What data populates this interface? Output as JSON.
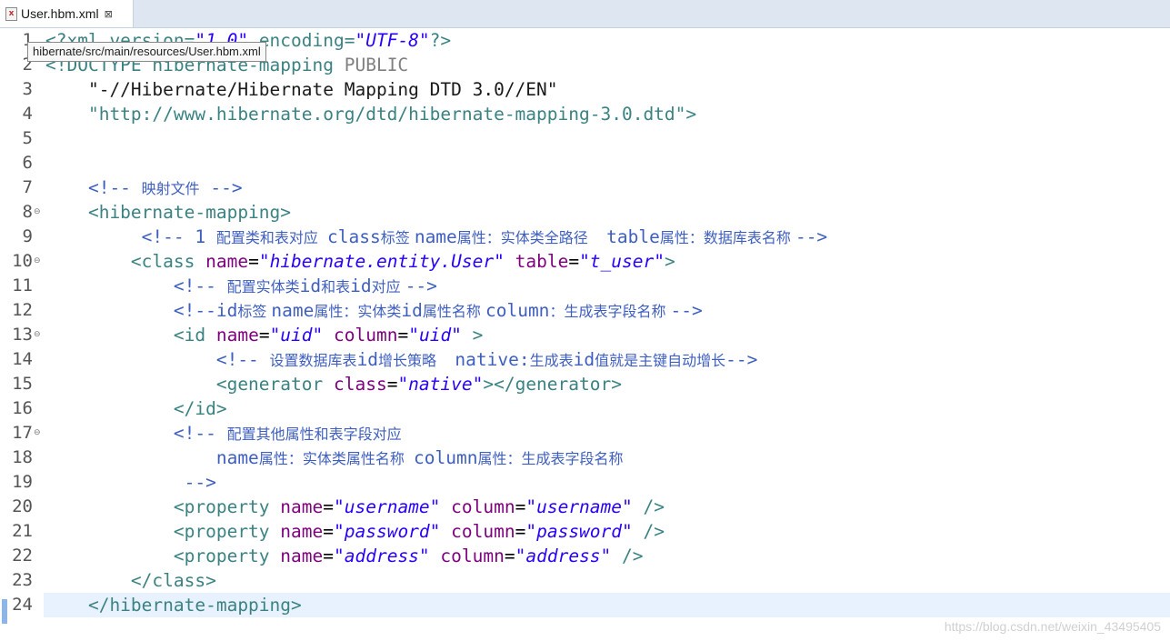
{
  "tab": {
    "label": "User.hbm.xml",
    "close": "⊠"
  },
  "tooltip": "hibernate/src/main/resources/User.hbm.xml",
  "watermark": "https://blog.csdn.net/weixin_43495405",
  "lines": [
    {
      "n": "1",
      "fold": false,
      "tokens": [
        [
          "c-tag",
          "<?xml version="
        ],
        [
          "c-str",
          "\"1.0\""
        ],
        [
          "c-tag",
          " encoding="
        ],
        [
          "c-str",
          "\"UTF-8\""
        ],
        [
          "c-tag",
          "?>"
        ]
      ]
    },
    {
      "n": "2",
      "fold": false,
      "tokens": [
        [
          "c-tag",
          "<!DOCTYPE hibernate-mapping "
        ],
        [
          "c-kw",
          "PUBLIC"
        ]
      ]
    },
    {
      "n": "3",
      "fold": false,
      "tokens": [
        [
          "c-dstr",
          "    \"-//Hibernate/Hibernate Mapping DTD 3.0//EN\""
        ]
      ]
    },
    {
      "n": "4",
      "fold": false,
      "tokens": [
        [
          "c-doc",
          "    \"http://www.hibernate.org/dtd/hibernate-mapping-3.0.dtd\""
        ],
        [
          "c-tag",
          ">"
        ]
      ]
    },
    {
      "n": "5",
      "fold": false,
      "tokens": []
    },
    {
      "n": "6",
      "fold": false,
      "tokens": []
    },
    {
      "n": "7",
      "fold": false,
      "tokens": [
        [
          "c-cmt",
          "    <!-- "
        ],
        [
          "c-cmt cjk",
          "映射文件"
        ],
        [
          "c-cmt",
          " -->"
        ]
      ]
    },
    {
      "n": "8",
      "fold": true,
      "tokens": [
        [
          "c-tag",
          "    <hibernate-mapping>"
        ]
      ]
    },
    {
      "n": "9",
      "fold": false,
      "tokens": [
        [
          "c-cmt",
          "         <!-- 1 "
        ],
        [
          "c-cmt cjk",
          "配置类和表对应  "
        ],
        [
          "c-cmt",
          "class"
        ],
        [
          "c-cmt cjk",
          "标签 "
        ],
        [
          "c-cmt",
          "name"
        ],
        [
          "c-cmt cjk",
          "属性：实体类全路径    "
        ],
        [
          "c-cmt",
          "table"
        ],
        [
          "c-cmt cjk",
          "属性：数据库表名称 "
        ],
        [
          "c-cmt",
          "-->"
        ]
      ]
    },
    {
      "n": "10",
      "fold": true,
      "tokens": [
        [
          "c-tag",
          "        <class "
        ],
        [
          "c-attr",
          "name"
        ],
        [
          "c-txt",
          "="
        ],
        [
          "c-str",
          "\"hibernate.entity.User\""
        ],
        [
          "c-txt",
          " "
        ],
        [
          "c-attr",
          "table"
        ],
        [
          "c-txt",
          "="
        ],
        [
          "c-str",
          "\"t_user\""
        ],
        [
          "c-tag",
          ">"
        ]
      ]
    },
    {
      "n": "11",
      "fold": false,
      "tokens": [
        [
          "c-cmt",
          "            <!-- "
        ],
        [
          "c-cmt cjk",
          "配置实体类"
        ],
        [
          "c-cmt",
          "id"
        ],
        [
          "c-cmt cjk",
          "和表"
        ],
        [
          "c-cmt",
          "id"
        ],
        [
          "c-cmt cjk",
          "对应 "
        ],
        [
          "c-cmt",
          "-->"
        ]
      ]
    },
    {
      "n": "12",
      "fold": false,
      "tokens": [
        [
          "c-cmt",
          "            <!--id"
        ],
        [
          "c-cmt cjk",
          "标签 "
        ],
        [
          "c-cmt",
          "name"
        ],
        [
          "c-cmt cjk",
          "属性：实体类"
        ],
        [
          "c-cmt",
          "id"
        ],
        [
          "c-cmt cjk",
          "属性名称 "
        ],
        [
          "c-cmt",
          "column"
        ],
        [
          "c-cmt cjk",
          "：生成表字段名称 "
        ],
        [
          "c-cmt",
          "-->"
        ]
      ]
    },
    {
      "n": "13",
      "fold": true,
      "tokens": [
        [
          "c-tag",
          "            <id "
        ],
        [
          "c-attr",
          "name"
        ],
        [
          "c-txt",
          "="
        ],
        [
          "c-str",
          "\"uid\""
        ],
        [
          "c-txt",
          " "
        ],
        [
          "c-attr",
          "column"
        ],
        [
          "c-txt",
          "="
        ],
        [
          "c-str",
          "\"uid\""
        ],
        [
          "c-tag",
          " >"
        ]
      ]
    },
    {
      "n": "14",
      "fold": false,
      "tokens": [
        [
          "c-cmt",
          "                <!-- "
        ],
        [
          "c-cmt cjk",
          "设置数据库表"
        ],
        [
          "c-cmt",
          "id"
        ],
        [
          "c-cmt cjk",
          "增长策略    "
        ],
        [
          "c-cmt",
          "native:"
        ],
        [
          "c-cmt cjk",
          "生成表"
        ],
        [
          "c-cmt",
          "id"
        ],
        [
          "c-cmt cjk",
          "值就是主键自动增长"
        ],
        [
          "c-cmt",
          "-->"
        ]
      ]
    },
    {
      "n": "15",
      "fold": false,
      "tokens": [
        [
          "c-tag",
          "                <generator "
        ],
        [
          "c-attr",
          "class"
        ],
        [
          "c-txt",
          "="
        ],
        [
          "c-str",
          "\"native\""
        ],
        [
          "c-tag",
          "></generator>"
        ]
      ]
    },
    {
      "n": "16",
      "fold": false,
      "tokens": [
        [
          "c-tag",
          "            </id>"
        ]
      ]
    },
    {
      "n": "17",
      "fold": true,
      "tokens": [
        [
          "c-cmt",
          "            <!-- "
        ],
        [
          "c-cmt cjk",
          "配置其他属性和表字段对应"
        ]
      ]
    },
    {
      "n": "18",
      "fold": false,
      "tokens": [
        [
          "c-cmt",
          "                name"
        ],
        [
          "c-cmt cjk",
          "属性：实体类属性名称  "
        ],
        [
          "c-cmt",
          "column"
        ],
        [
          "c-cmt cjk",
          "属性：生成表字段名称"
        ]
      ]
    },
    {
      "n": "19",
      "fold": false,
      "tokens": [
        [
          "c-cmt",
          "             -->"
        ]
      ]
    },
    {
      "n": "20",
      "fold": false,
      "tokens": [
        [
          "c-tag",
          "            <property "
        ],
        [
          "c-attr",
          "name"
        ],
        [
          "c-txt",
          "="
        ],
        [
          "c-str",
          "\"username\""
        ],
        [
          "c-txt",
          " "
        ],
        [
          "c-attr",
          "column"
        ],
        [
          "c-txt",
          "="
        ],
        [
          "c-str",
          "\"username\""
        ],
        [
          "c-tag",
          " />"
        ]
      ]
    },
    {
      "n": "21",
      "fold": false,
      "tokens": [
        [
          "c-tag",
          "            <property "
        ],
        [
          "c-attr",
          "name"
        ],
        [
          "c-txt",
          "="
        ],
        [
          "c-str",
          "\"password\""
        ],
        [
          "c-txt",
          " "
        ],
        [
          "c-attr",
          "column"
        ],
        [
          "c-txt",
          "="
        ],
        [
          "c-str",
          "\"password\""
        ],
        [
          "c-tag",
          " />"
        ]
      ]
    },
    {
      "n": "22",
      "fold": false,
      "tokens": [
        [
          "c-tag",
          "            <property "
        ],
        [
          "c-attr",
          "name"
        ],
        [
          "c-txt",
          "="
        ],
        [
          "c-str",
          "\"address\""
        ],
        [
          "c-txt",
          " "
        ],
        [
          "c-attr",
          "column"
        ],
        [
          "c-txt",
          "="
        ],
        [
          "c-str",
          "\"address\""
        ],
        [
          "c-tag",
          " />"
        ]
      ]
    },
    {
      "n": "23",
      "fold": false,
      "tokens": [
        [
          "c-tag",
          "        </class>"
        ]
      ]
    },
    {
      "n": "24",
      "fold": false,
      "current": true,
      "tokens": [
        [
          "c-tag",
          "    </hibernate-mapping>"
        ]
      ]
    }
  ]
}
